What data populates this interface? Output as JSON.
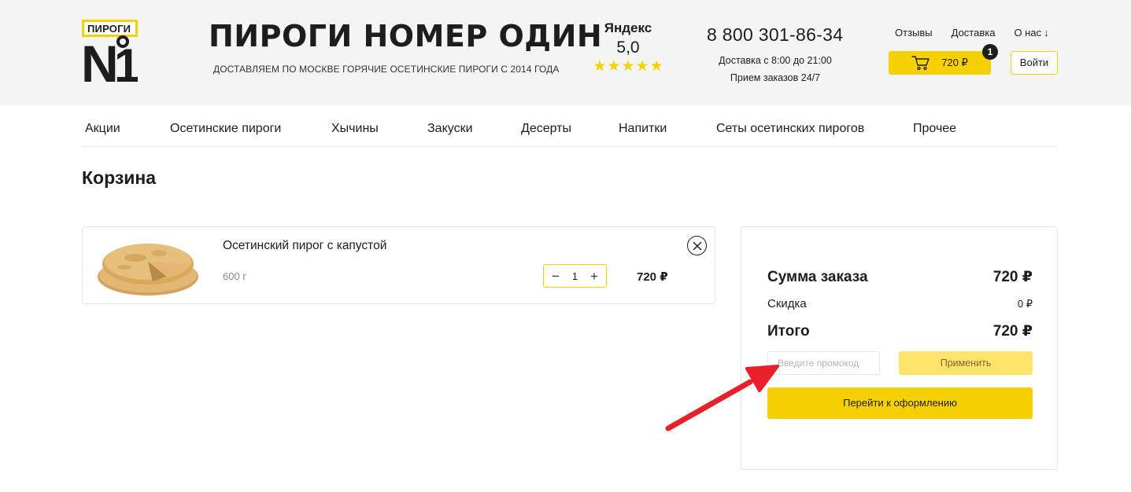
{
  "header": {
    "logo_top_text": "ПИРОГИ",
    "logo_number": "N1",
    "brand_title": "ПИРОГИ НОМЕР ОДИН",
    "brand_subtitle": "ДОСТАВЛЯЕМ ПО МОСКВЕ ГОРЯЧИЕ ОСЕТИНСКИЕ ПИРОГИ С 2014 ГОДА",
    "rating_source": "Яндекс",
    "rating_value": "5,0",
    "rating_stars": 5,
    "phone": "8 800 301-86-34",
    "delivery_hours": "Доставка с 8:00 до 21:00",
    "order_hours": "Прием заказов 24/7",
    "links": [
      "Отзывы",
      "Доставка",
      "О нас"
    ],
    "about_arrow": "↓",
    "cart_total": "720 ₽",
    "cart_count": "1",
    "login_label": "Войти"
  },
  "nav": {
    "items": [
      "Акции",
      "Осетинские пироги",
      "Хычины",
      "Закуски",
      "Десерты",
      "Напитки",
      "Сеты осетинских пирогов",
      "Прочее"
    ]
  },
  "page_title": "Корзина",
  "cart_item": {
    "name": "Осетинский пирог с капустой",
    "weight": "600 г",
    "quantity": "1",
    "minus": "−",
    "plus": "+",
    "price": "720 ₽",
    "remove_icon": "close-icon"
  },
  "summary": {
    "subtotal_label": "Сумма заказа",
    "subtotal_value": "720 ₽",
    "discount_label": "Скидка",
    "discount_value": "0 ₽",
    "total_label": "Итого",
    "total_value": "720 ₽",
    "promo_placeholder": "Введите промокод",
    "apply_label": "Применить",
    "checkout_label": "Перейти к оформлению"
  },
  "colors": {
    "accent": "#f7d000",
    "accent_light": "#fce36a",
    "header_bg": "#f4f4f4",
    "annotation_arrow": "#e8202a"
  }
}
